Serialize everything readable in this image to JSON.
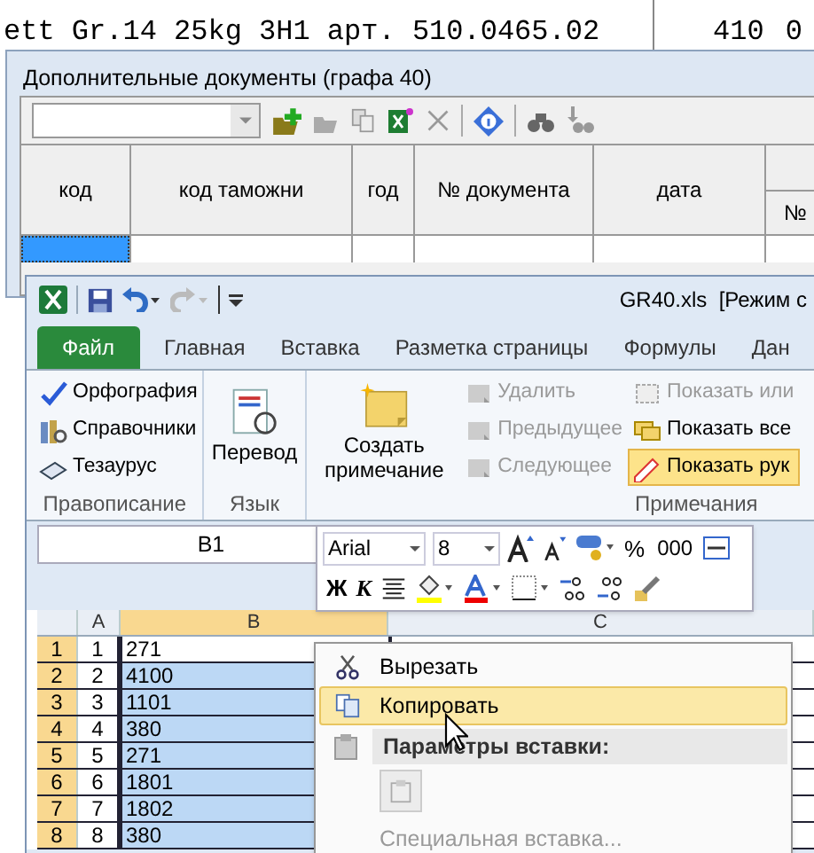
{
  "background_document": {
    "line": "ett Gr.14 25kg 3H1 арт. 510.0465.02",
    "right_values": [
      "410",
      "0"
    ]
  },
  "dialog": {
    "title": "Дополнительные документы (графа 40)",
    "columns": [
      "код",
      "код таможни",
      "год",
      "№ документа",
      "дата",
      "№"
    ],
    "rows": [
      {
        "selected": true
      }
    ]
  },
  "excel": {
    "title": "GR40.xls  [Режим с",
    "tabs": [
      {
        "label": "Файл",
        "kind": "file"
      },
      {
        "label": "Главная",
        "kind": "tab"
      },
      {
        "label": "Вставка",
        "kind": "tab"
      },
      {
        "label": "Разметка страницы",
        "kind": "tab"
      },
      {
        "label": "Формулы",
        "kind": "tab"
      },
      {
        "label": "Дан",
        "kind": "tab"
      }
    ],
    "groups": [
      {
        "label": "Правописание",
        "items": [
          {
            "label": "Орфография",
            "disabled": false,
            "active": false
          },
          {
            "label": "Справочники",
            "disabled": false,
            "active": false
          },
          {
            "label": "Тезаурус",
            "disabled": false,
            "active": false
          }
        ]
      },
      {
        "label": "Язык",
        "items": [
          {
            "label": "Перевод",
            "disabled": false,
            "active": false
          }
        ]
      },
      {
        "label": "Примечания",
        "items": [
          {
            "label": "Создать примечание",
            "disabled": false,
            "active": false
          },
          {
            "label": "Удалить",
            "disabled": true,
            "active": false
          },
          {
            "label": "Предыдущее",
            "disabled": true,
            "active": false
          },
          {
            "label": "Следующее",
            "disabled": true,
            "active": false
          },
          {
            "label": "Показать или",
            "disabled": true,
            "active": false
          },
          {
            "label": "Показать все",
            "disabled": false,
            "active": false
          },
          {
            "label": "Показать рук",
            "disabled": false,
            "active": true
          }
        ]
      }
    ],
    "name_box": "B1",
    "column_headers": [
      "A",
      "B",
      "C"
    ],
    "rows": [
      {
        "number": "1",
        "a": "1",
        "b": "271",
        "active": true
      },
      {
        "number": "2",
        "a": "2",
        "b": "4100",
        "active": false
      },
      {
        "number": "3",
        "a": "3",
        "b": "1101",
        "active": false
      },
      {
        "number": "4",
        "a": "4",
        "b": "380",
        "active": false
      },
      {
        "number": "5",
        "a": "5",
        "b": "271",
        "active": false
      },
      {
        "number": "6",
        "a": "6",
        "b": "1801",
        "active": false
      },
      {
        "number": "7",
        "a": "7",
        "b": "1802",
        "active": false
      },
      {
        "number": "8",
        "a": "8",
        "b": "380",
        "active": false
      }
    ]
  },
  "mini_toolbar": {
    "font": "Arial",
    "size": "8",
    "percent": "%",
    "thousands": "000",
    "bold": "Ж",
    "italic": "К"
  },
  "context_menu": [
    {
      "kind": "item",
      "label": "Вырезать",
      "selected": false,
      "disabled": false
    },
    {
      "kind": "item",
      "label": "Копировать",
      "selected": true,
      "disabled": false
    },
    {
      "kind": "header",
      "label": "Параметры вставки:"
    },
    {
      "kind": "paste_options"
    },
    {
      "kind": "item",
      "label": "Специальная вставка...",
      "selected": false,
      "disabled": true
    }
  ]
}
